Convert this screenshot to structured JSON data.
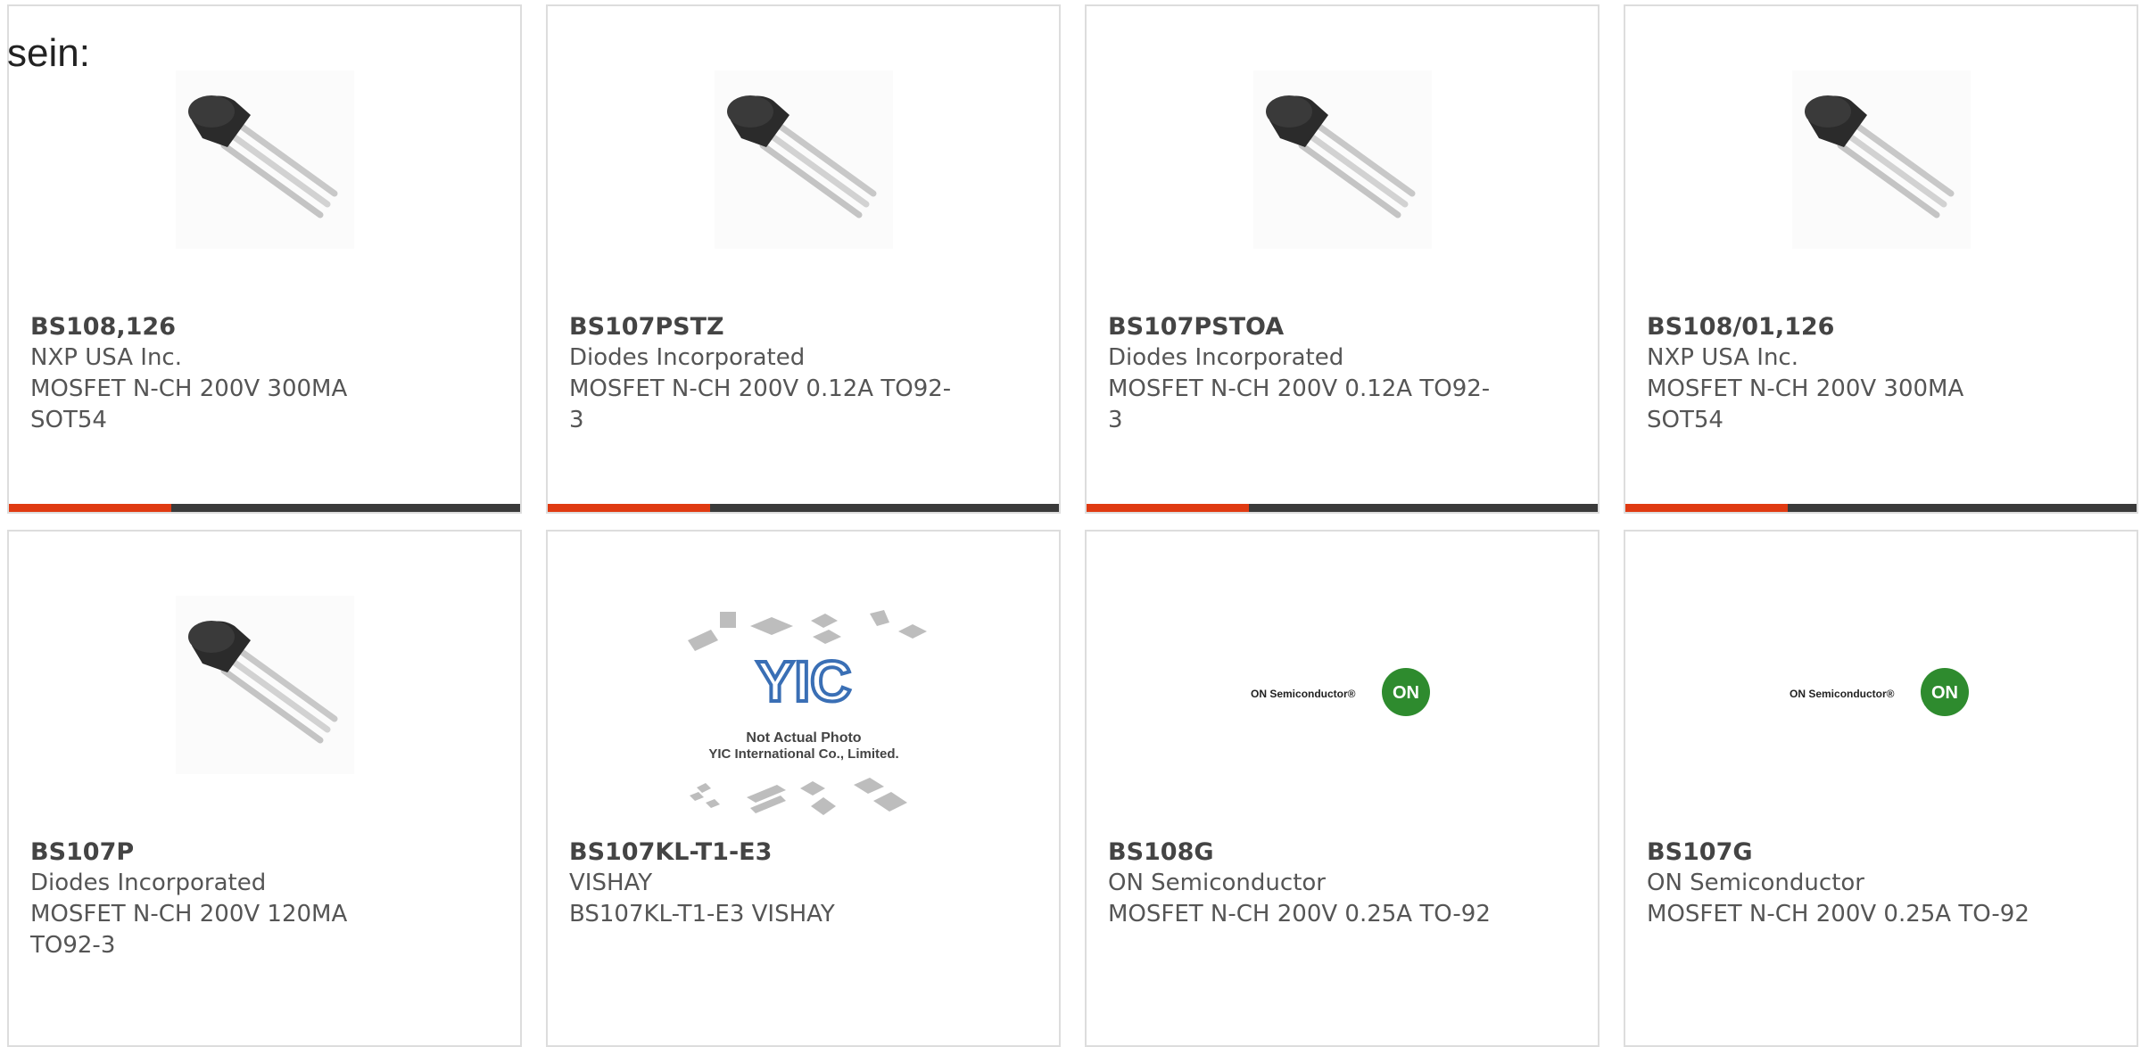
{
  "intro_text": "sein:",
  "colors": {
    "accent": "#e03a12",
    "bar": "#3a3a3a",
    "border": "#dddddd"
  },
  "products": [
    {
      "pn": "BS108,126",
      "mfr": "NXP USA Inc.",
      "desc": "MOSFET N-CH 200V 300MA\nSOT54",
      "image": "to92-transistor-icon"
    },
    {
      "pn": "BS107PSTZ",
      "mfr": "Diodes Incorporated",
      "desc": "MOSFET N-CH 200V 0.12A TO92-\n3",
      "image": "to92-transistor-icon"
    },
    {
      "pn": "BS107PSTOA",
      "mfr": "Diodes Incorporated",
      "desc": "MOSFET N-CH 200V 0.12A TO92-\n3",
      "image": "to92-transistor-icon"
    },
    {
      "pn": "BS108/01,126",
      "mfr": "NXP USA Inc.",
      "desc": "MOSFET N-CH 200V 300MA\nSOT54",
      "image": "to92-transistor-icon"
    },
    {
      "pn": "BS107P",
      "mfr": "Diodes Incorporated",
      "desc": "MOSFET N-CH 200V 120MA\nTO92-3",
      "image": "to92-transistor-icon"
    },
    {
      "pn": "BS107KL-T1-E3",
      "mfr": "VISHAY",
      "desc": "BS107KL-T1-E3 VISHAY",
      "image": "yic-placeholder-image"
    },
    {
      "pn": "BS108G",
      "mfr": "ON Semiconductor",
      "desc": "MOSFET N-CH 200V 0.25A TO-92",
      "image": "on-semiconductor-logo"
    },
    {
      "pn": "BS107G",
      "mfr": "ON Semiconductor",
      "desc": "MOSFET N-CH 200V 0.25A TO-92",
      "image": "on-semiconductor-logo"
    }
  ],
  "placeholder": {
    "line1": "Not Actual Photo",
    "line2": "YIC International Co., Limited.",
    "logo": "YIC"
  },
  "on_logo": {
    "wordmark": "ON Semiconductor®",
    "badge": "ON"
  }
}
